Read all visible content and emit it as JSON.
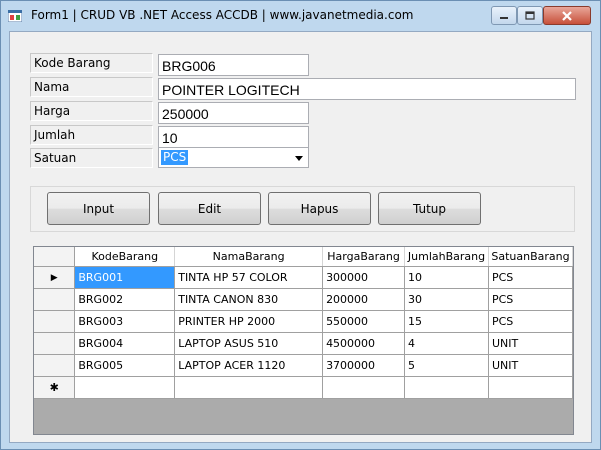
{
  "window": {
    "title": "Form1 | CRUD VB .NET Access ACCDB | www.javanetmedia.com",
    "icons": [
      "app-icon",
      "minimize-icon",
      "maximize-icon",
      "close-icon"
    ]
  },
  "form": {
    "kode_label": "Kode Barang",
    "kode_value": "BRG006",
    "nama_label": "Nama",
    "nama_value": "POINTER LOGITECH",
    "harga_label": "Harga",
    "harga_value": "250000",
    "jumlah_label": "Jumlah",
    "jumlah_value": "10",
    "satuan_label": "Satuan",
    "satuan_value": "PCS"
  },
  "buttons": {
    "input": "Input",
    "edit": "Edit",
    "hapus": "Hapus",
    "tutup": "Tutup"
  },
  "grid": {
    "columns": [
      "KodeBarang",
      "NamaBarang",
      "HargaBarang",
      "JumlahBarang",
      "SatuanBarang"
    ],
    "rows": [
      [
        "BRG001",
        "TINTA HP 57 COLOR",
        "300000",
        "10",
        "PCS"
      ],
      [
        "BRG002",
        "TINTA CANON 830",
        "200000",
        "30",
        "PCS"
      ],
      [
        "BRG003",
        "PRINTER HP 2000",
        "550000",
        "15",
        "PCS"
      ],
      [
        "BRG004",
        "LAPTOP ASUS 510",
        "4500000",
        "4",
        "UNIT"
      ],
      [
        "BRG005",
        "LAPTOP ACER 1120",
        "3700000",
        "5",
        "UNIT"
      ]
    ],
    "current_row_marker": "▶",
    "new_row_marker": "✱"
  },
  "colors": {
    "selection": "#3399ff",
    "window_frame": "#bfd8ee",
    "close_button": "#c7503a"
  }
}
